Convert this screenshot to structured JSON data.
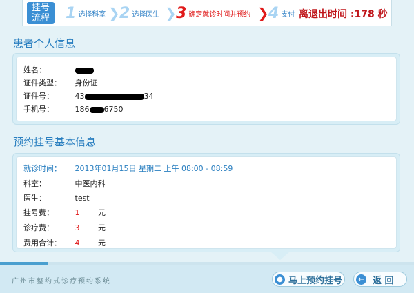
{
  "steps_bar": {
    "flow_label_line1": "挂号",
    "flow_label_line2": "流程",
    "steps": [
      {
        "num": "1",
        "label": "选择科室"
      },
      {
        "num": "2",
        "label": "选择医生"
      },
      {
        "num": "3",
        "label": "确定就诊时间并预约"
      },
      {
        "num": "4",
        "label": "支付"
      }
    ],
    "countdown_prefix": "离退出时间 :",
    "countdown_value": "178",
    "countdown_unit": "秒"
  },
  "personal": {
    "title": "患者个人信息",
    "name_label": "姓名：",
    "idtype_label": "证件类型：",
    "idtype_value": "身份证",
    "idno_label": "证件号：",
    "idno_prefix": "43",
    "idno_suffix": "34",
    "phone_label": "手机号：",
    "phone_prefix": "186",
    "phone_suffix": "6750"
  },
  "booking": {
    "title": "预约挂号基本信息",
    "visit_label": "就诊时间：",
    "visit_value": "2013年01月15日 星期二 上午 08:00 - 08:59",
    "dept_label": "科室：",
    "dept_value": "中医内科",
    "doctor_label": "医生：",
    "doctor_value": "test",
    "reg_fee_label": "挂号费：",
    "reg_fee_value": "1",
    "treat_fee_label": "诊疗费：",
    "treat_fee_value": "3",
    "total_label": "费用合计：",
    "total_value": "4",
    "currency": "元"
  },
  "footer": {
    "brand": "广州市整约式诊疗预约系统",
    "book_button": "马上预约挂号",
    "back_button": "返 回",
    "progress_fraction": 0.115
  },
  "colors": {
    "accent": "#2a7fc0",
    "active_step": "#e01a1a",
    "countdown": "#c0161b"
  }
}
